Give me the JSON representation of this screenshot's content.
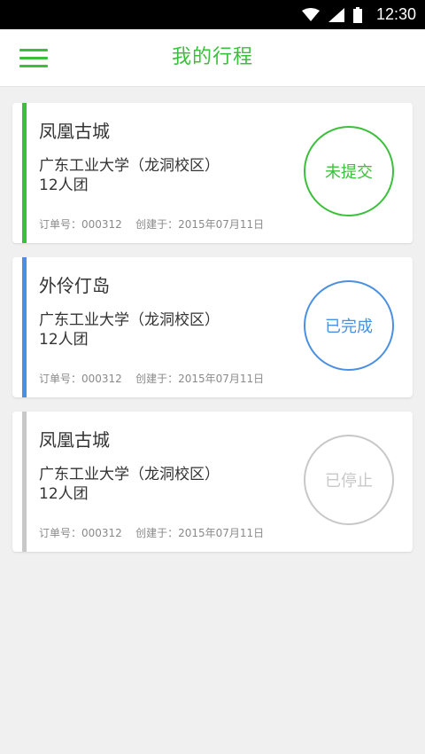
{
  "statusbar": {
    "time": "12:30",
    "icons": [
      "wifi-icon",
      "signal-icon",
      "battery-icon"
    ]
  },
  "appbar": {
    "title": "我的行程",
    "menu_icon": "hamburger-menu-icon",
    "accent": "#3cbf3c"
  },
  "trips": [
    {
      "name": "凤凰古城",
      "school": "广东工业大学（龙洞校区）",
      "group": "12人团",
      "order_label": "订单号：000312",
      "created_label": "创建于：2015年07月11日",
      "status": "未提交",
      "color": "#3cbf3c"
    },
    {
      "name": "外伶仃岛",
      "school": "广东工业大学（龙洞校区）",
      "group": "12人团",
      "order_label": "订单号：000312",
      "created_label": "创建于：2015年07月11日",
      "status": "已完成",
      "color": "#4a90e2"
    },
    {
      "name": "凤凰古城",
      "school": "广东工业大学（龙洞校区）",
      "group": "12人团",
      "order_label": "订单号：000312",
      "created_label": "创建于：2015年07月11日",
      "status": "已停止",
      "color": "#c8c8c8"
    }
  ]
}
